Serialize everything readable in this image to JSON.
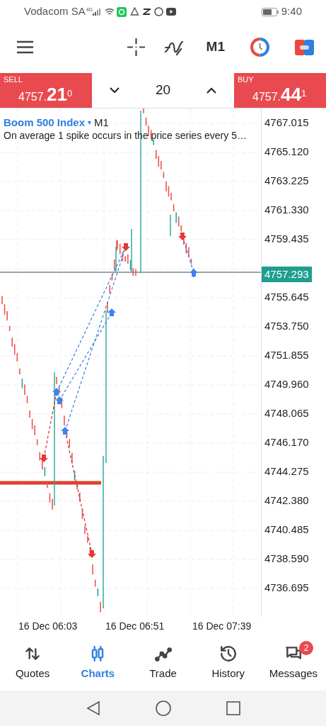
{
  "status_bar": {
    "carrier": "Vodacom SA",
    "network": "4G",
    "time": "9:40"
  },
  "toolbar": {
    "timeframe": "M1"
  },
  "trade_bar": {
    "sell": {
      "label": "SELL",
      "price_main": "4757.",
      "price_big": "21",
      "price_sup": "0"
    },
    "volume": "20",
    "buy": {
      "label": "BUY",
      "price_main": "4757.",
      "price_big": "44",
      "price_sup": "1"
    }
  },
  "chart": {
    "symbol": "Boom 500 Index",
    "caret": "▾",
    "timeframe": "M1",
    "description": "On average 1 spike occurs in the price series every 5…",
    "price_labels_above": [
      "4767.015",
      "4765.120",
      "4763.225",
      "4761.330",
      "4759.435"
    ],
    "current_price": "4757.293",
    "price_labels_below": [
      "4755.645",
      "4753.750",
      "4751.855",
      "4749.960",
      "4748.065",
      "4746.170",
      "4744.275",
      "4742.380",
      "4740.485",
      "4738.590",
      "4736.695"
    ],
    "time_labels": [
      "16 Dec 06:03",
      "16 Dec 06:51",
      "16 Dec 07:39"
    ]
  },
  "nav": [
    {
      "label": "Quotes",
      "selected": false
    },
    {
      "label": "Charts",
      "selected": true
    },
    {
      "label": "Trade",
      "selected": false
    },
    {
      "label": "History",
      "selected": false
    },
    {
      "label": "Messages",
      "selected": false,
      "badge": "2"
    }
  ]
}
